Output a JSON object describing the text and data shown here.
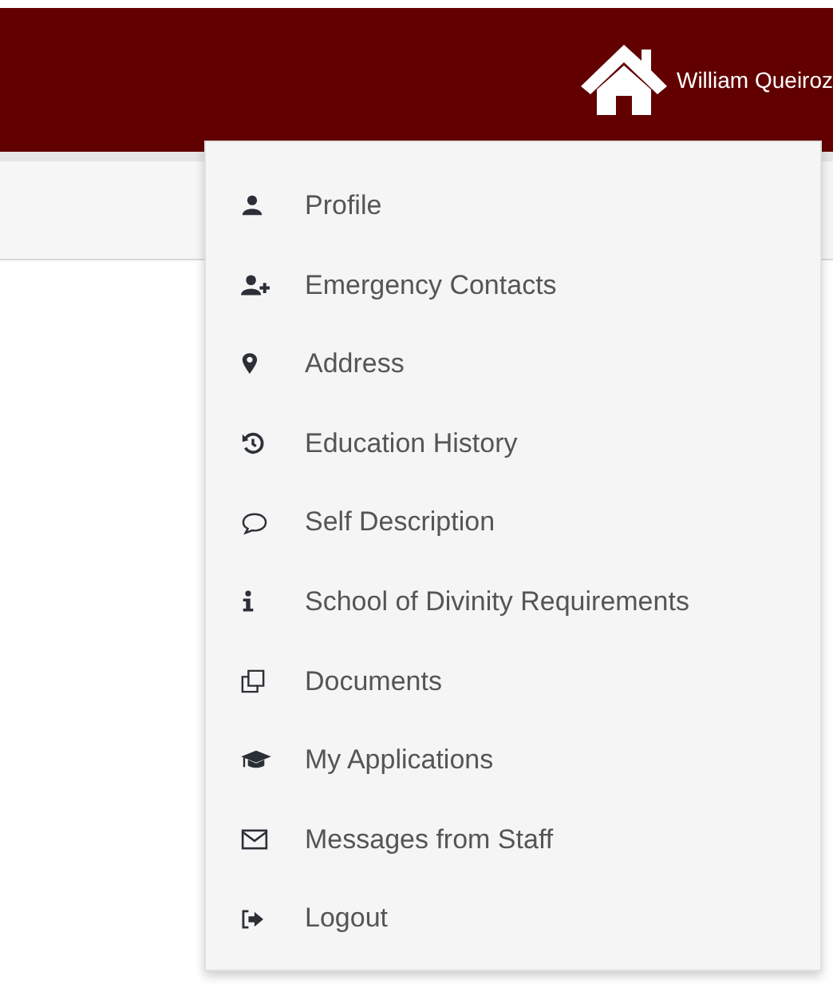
{
  "header": {
    "user_name": "William Queiroz"
  },
  "menu": {
    "items": [
      {
        "label": "Profile",
        "kind": "person"
      },
      {
        "label": "Emergency Contacts",
        "kind": "person-add"
      },
      {
        "label": "Address",
        "kind": "pin"
      },
      {
        "label": "Education History",
        "kind": "history"
      },
      {
        "label": "Self Description",
        "kind": "comment"
      },
      {
        "label": "School of Divinity Requirements",
        "kind": "info"
      },
      {
        "label": "Documents",
        "kind": "documents"
      },
      {
        "label": "My Applications",
        "kind": "graduation"
      },
      {
        "label": "Messages from Staff",
        "kind": "envelope"
      },
      {
        "label": "Logout",
        "kind": "logout"
      }
    ]
  }
}
